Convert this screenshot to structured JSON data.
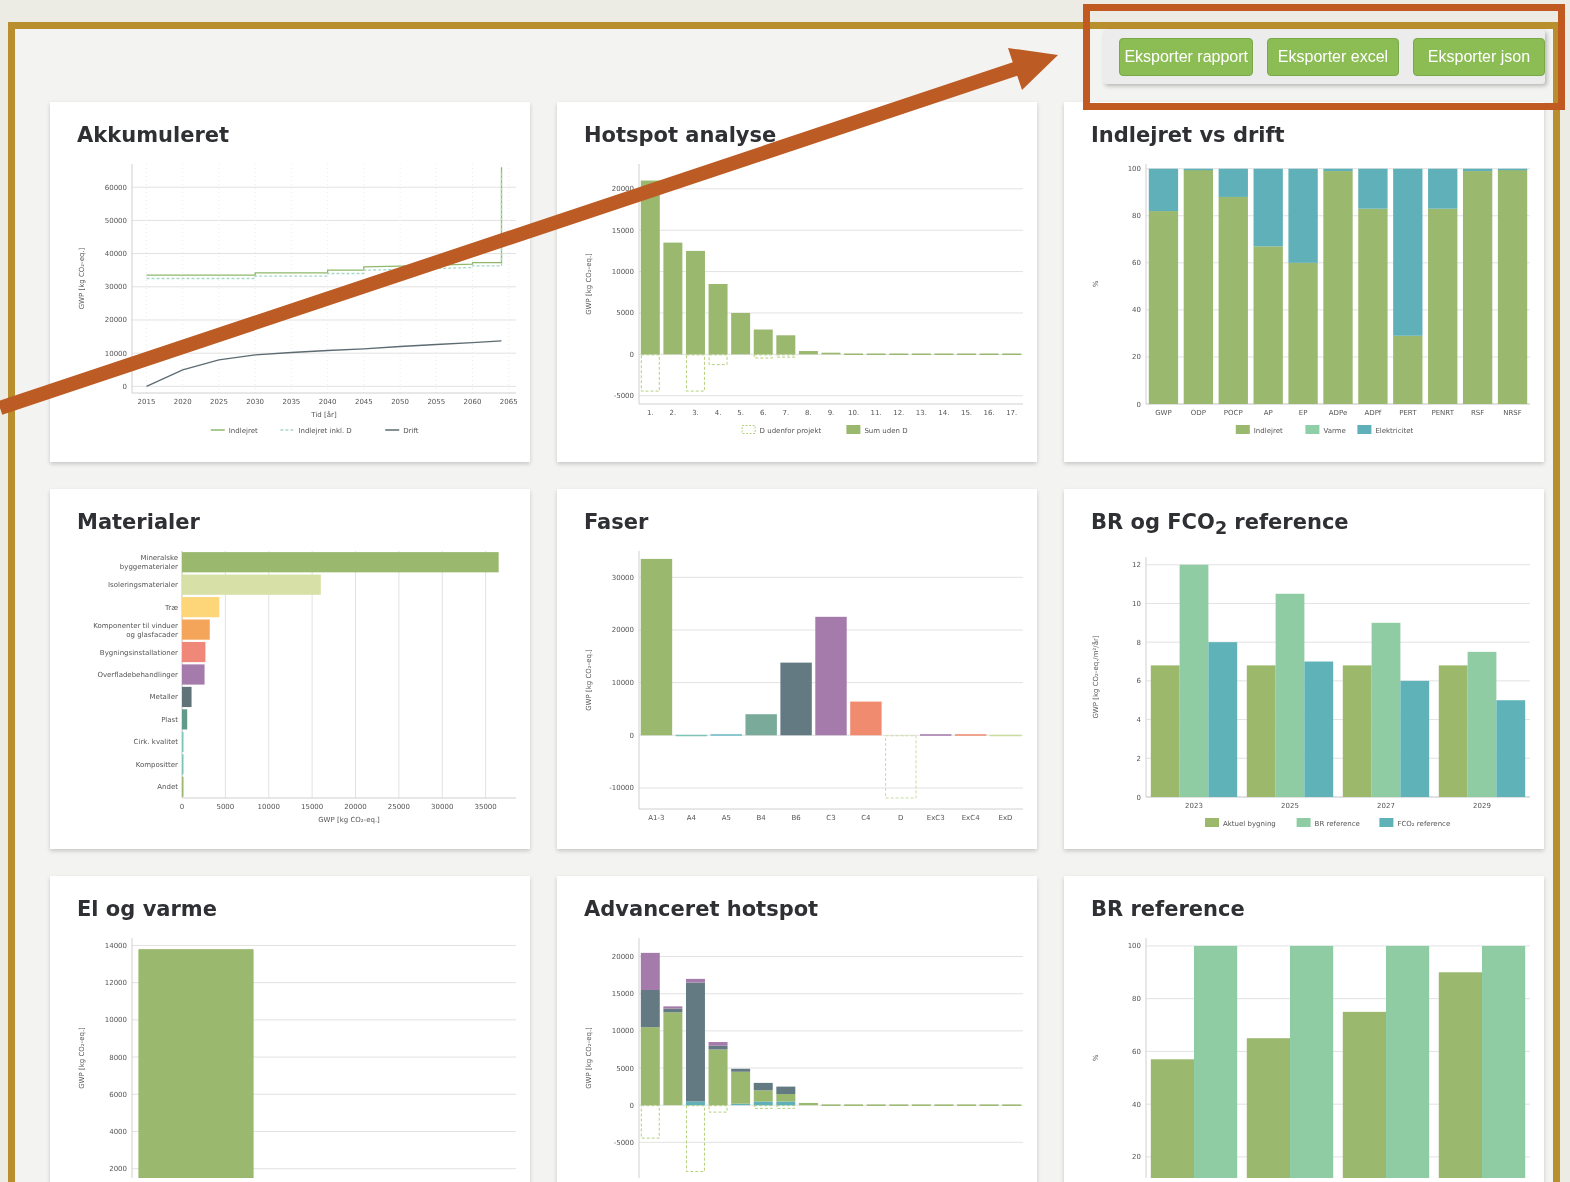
{
  "toolbar": {
    "buttons": [
      "Eksporter rapport",
      "Eksporter excel",
      "Eksporter json"
    ]
  },
  "cards": [
    {
      "title": "Akkumuleret",
      "chart_data": {
        "type": "line",
        "grid": true,
        "legend": "bottom",
        "xlabel": "Tid [år]",
        "ylabel": "GWP [kg CO₂-eq.]",
        "x": [
          2015,
          2020,
          2025,
          2030,
          2030,
          2035,
          2040,
          2040,
          2045,
          2045,
          2050,
          2055,
          2060,
          2060,
          2064,
          2064
        ],
        "xlim": [
          2013,
          2066
        ],
        "ylim": [
          -2000,
          67000
        ],
        "xticks": [
          2015,
          2020,
          2025,
          2030,
          2035,
          2040,
          2045,
          2050,
          2055,
          2060,
          2065
        ],
        "yticks": [
          0,
          10000,
          20000,
          30000,
          40000,
          50000,
          60000
        ],
        "series": [
          {
            "name": "Indlejret",
            "color": "#8fb86a",
            "values": [
              33500,
              33500,
              33500,
              33500,
              34200,
              34200,
              34200,
              35000,
              35000,
              36000,
              36200,
              36500,
              36800,
              37300,
              37300,
              66000
            ]
          },
          {
            "name": "Indlejret inkl. D",
            "color": "#a8d8c8",
            "line_style": "dashed",
            "values": [
              32500,
              32500,
              32500,
              32500,
              33200,
              33200,
              33200,
              34000,
              34000,
              35000,
              35200,
              35500,
              35800,
              36300,
              36300,
              65000
            ]
          },
          {
            "name": "Drift",
            "color": "#5c6b72",
            "values": [
              0,
              5000,
              8000,
              9500,
              9500,
              10200,
              10800,
              10800,
              11300,
              11300,
              12000,
              12600,
              13200,
              13200,
              13700,
              13700
            ]
          }
        ]
      }
    },
    {
      "title": "Hotspot analyse",
      "chart_data": {
        "type": "bar",
        "grid": true,
        "legend": "bottom",
        "stacked": true,
        "ylabel": "GWP [kg CO₂-eq.]",
        "categories": [
          "1.",
          "2.",
          "3.",
          "4.",
          "5.",
          "6.",
          "7.",
          "8.",
          "9.",
          "10.",
          "11.",
          "12.",
          "13.",
          "14.",
          "15.",
          "16.",
          "17."
        ],
        "ylim": [
          -6000,
          23000
        ],
        "yticks": [
          -5000,
          0,
          5000,
          10000,
          15000,
          20000
        ],
        "series": [
          {
            "name": "D udenfor projekt",
            "color": "#b5cf7e",
            "values": [
              -4500,
              0,
              -4500,
              -1300,
              0,
              -500,
              -400,
              0,
              0,
              0,
              0,
              0,
              0,
              0,
              0,
              0,
              0
            ]
          },
          {
            "name": "Sum uden D",
            "color": "#9ab86e",
            "values": [
              21000,
              13500,
              12500,
              8500,
              5000,
              3000,
              2300,
              400,
              200,
              100,
              100,
              100,
              100,
              100,
              100,
              100,
              100
            ]
          }
        ]
      }
    },
    {
      "title": "Indlejret vs drift",
      "chart_data": {
        "type": "bar",
        "grid": true,
        "legend": "bottom",
        "stacked": true,
        "ylabel": "%",
        "categories": [
          "GWP",
          "ODP",
          "POCP",
          "AP",
          "EP",
          "ADPe",
          "ADPf",
          "PERT",
          "PENRT",
          "RSF",
          "NRSF"
        ],
        "ylim": [
          0,
          102
        ],
        "yticks": [
          0,
          20,
          40,
          60,
          80,
          100
        ],
        "series": [
          {
            "name": "Indlejret",
            "color": "#9ab86e",
            "values": [
              82,
              99.5,
              88,
              67,
              60,
              99,
              83,
              29,
              83,
              99,
              99.7
            ]
          },
          {
            "name": "Varme",
            "color": "#8ecfa8",
            "values": [
              0,
              0,
              0,
              0,
              0,
              0,
              0,
              0,
              0,
              0,
              0
            ]
          },
          {
            "name": "Elektricitet",
            "color": "#5fb0b8",
            "values": [
              18,
              0.5,
              12,
              33,
              40,
              1,
              17,
              71,
              17,
              1,
              0.3
            ]
          }
        ]
      }
    },
    {
      "title": "Materialer",
      "chart_data": {
        "type": "bar",
        "grid": true,
        "orientation": "horizontal",
        "xlabel": "GWP [kg CO₂-eq.]",
        "categories": [
          "Mineralske\nbyggematerialer",
          "Isoleringsmaterialer",
          "Træ",
          "Komponenter til vinduer\nog glasfacader",
          "Bygningsinstallationer",
          "Overfladebehandlinger",
          "Metaller",
          "Plast",
          "Cirk. kvalitet",
          "Kompositter",
          "Andet"
        ],
        "xlim": [
          0,
          38500
        ],
        "xticks": [
          0,
          5000,
          10000,
          15000,
          20000,
          25000,
          30000,
          35000
        ],
        "series": [
          {
            "colors": [
              "#9ab86e",
              "#d7e0a6",
              "#fdd67a",
              "#f4a55a",
              "#f0887a",
              "#a57bab",
              "#5f7378",
              "#5f9a8a",
              "#7fc4b8",
              "#7fc4b8",
              "#9ab86e"
            ],
            "values": [
              36500,
              16000,
              4300,
              3200,
              2700,
              2600,
              1100,
              600,
              100,
              100,
              100
            ]
          }
        ]
      }
    },
    {
      "title": "Faser",
      "chart_data": {
        "type": "bar",
        "grid": true,
        "ylabel": "GWP [kg CO₂-eq.]",
        "categories": [
          "A1-3",
          "A4",
          "A5",
          "B4",
          "B6",
          "C3",
          "C4",
          "D",
          "ExC3",
          "ExC4",
          "ExD"
        ],
        "ylim": [
          -14000,
          35000
        ],
        "yticks": [
          -10000,
          0,
          10000,
          20000,
          30000
        ],
        "series": [
          {
            "colors": [
              "#9ab86e",
              "#7fc4b8",
              "#6cbcc4",
              "#7aaa9a",
              "#647a82",
              "#a57bab",
              "#f08b70",
              "#c8dca0",
              "#a57bab",
              "#f08b70",
              "#c8dca0"
            ],
            "values": [
              33500,
              100,
              200,
              4000,
              13800,
              22500,
              6400,
              -12000,
              200,
              200,
              100
            ]
          }
        ]
      }
    },
    {
      "title": "BR og FCO$_{2}$ reference",
      "chart_data": {
        "type": "bar",
        "grid": true,
        "legend": "bottom",
        "ylabel": "GWP [kg CO₂-eq./m²/år]",
        "categories": [
          "2023",
          "2025",
          "2027",
          "2029"
        ],
        "ylim": [
          0,
          12.4
        ],
        "yticks": [
          0,
          2,
          4,
          6,
          8,
          10,
          12
        ],
        "series": [
          {
            "name": "Aktuel bygning",
            "color": "#9cb86a",
            "values": [
              6.8,
              6.8,
              6.8,
              6.8
            ]
          },
          {
            "name": "BR reference",
            "color": "#8fcca3",
            "values": [
              12,
              10.5,
              9,
              7.5
            ]
          },
          {
            "name": "FCO₂ reference",
            "color": "#5fb3b8",
            "values": [
              8,
              7,
              6,
              5
            ]
          }
        ]
      }
    },
    {
      "title": "El og varme",
      "chart_data": {
        "type": "bar",
        "grid": true,
        "ylabel": "GWP [kg CO₂-eq.]",
        "ylim": [
          1500,
          14400
        ],
        "yticks": [
          2000,
          4000,
          6000,
          8000,
          10000,
          12000,
          14000
        ],
        "series": [
          {
            "color": "#9ab86e",
            "values": [
              13800,
              null,
              null
            ]
          }
        ]
      }
    },
    {
      "title": "Advanceret hotspot",
      "chart_data": {
        "type": "bar",
        "grid": true,
        "stacked": true,
        "ylabel": "GWP [kg CO₂-eq.]",
        "ylim": [
          -9800,
          22500
        ],
        "yticks": [
          -5000,
          0,
          5000,
          10000,
          15000,
          20000
        ],
        "series": [
          {
            "color": "#b5cf7e",
            "values": [
              -4500,
              0,
              -9000,
              -1000,
              0,
              -500,
              -500,
              0,
              0,
              0,
              0,
              0,
              0,
              0,
              0,
              0,
              0
            ]
          },
          {
            "color": "#5fb0b8",
            "values": [
              0,
              0,
              500,
              0,
              200,
              500,
              500,
              0,
              0,
              0,
              0,
              0,
              0,
              0,
              0,
              0,
              0
            ]
          },
          {
            "color": "#9ab86e",
            "values": [
              10500,
              12500,
              0,
              7500,
              4300,
              1500,
              1000,
              300,
              100,
              100,
              100,
              100,
              100,
              100,
              100,
              100,
              100
            ]
          },
          {
            "color": "#647a82",
            "values": [
              5000,
              500,
              16000,
              500,
              400,
              1000,
              1000,
              0,
              0,
              0,
              0,
              0,
              0,
              0,
              0,
              0,
              0
            ]
          },
          {
            "color": "#a57bab",
            "values": [
              5000,
              300,
              500,
              500,
              0,
              0,
              0,
              0,
              0,
              0,
              0,
              0,
              0,
              0,
              0,
              0,
              0
            ]
          }
        ]
      }
    },
    {
      "title": "BR reference",
      "chart_data": {
        "type": "bar",
        "grid": true,
        "ylabel": "%",
        "ylim": [
          12,
          103
        ],
        "yticks": [
          20,
          40,
          60,
          80,
          100
        ],
        "series": [
          {
            "color": "#9ab86e",
            "values": [
              57,
              65,
              75,
              90
            ]
          },
          {
            "color": "#8fcca3",
            "values": [
              100,
              100,
              100,
              100
            ]
          }
        ]
      }
    }
  ]
}
